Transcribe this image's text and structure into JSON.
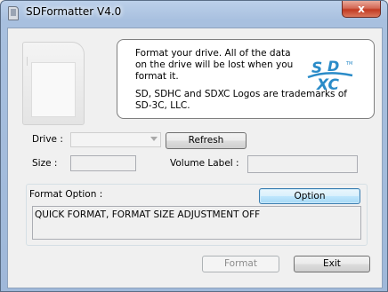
{
  "window": {
    "title": "SDFormatter V4.0",
    "close_label": "x"
  },
  "info": {
    "lines": [
      "Format your drive. All of the data",
      "on the drive will be lost when you",
      "format it."
    ],
    "trademark_lines": [
      "SD, SDHC and SDXC Logos are trademarks of",
      "SD-3C, LLC."
    ],
    "logo_text": "SDXC"
  },
  "drive": {
    "label": "Drive :",
    "selected_value": "",
    "refresh_label": "Refresh"
  },
  "size": {
    "label": "Size  :",
    "value": ""
  },
  "volume_label": {
    "label": "Volume Label :",
    "value": ""
  },
  "format_option": {
    "label": "Format Option :",
    "option_button_label": "Option",
    "status_text": "QUICK FORMAT, FORMAT SIZE ADJUSTMENT OFF"
  },
  "actions": {
    "format_label": "Format",
    "exit_label": "Exit"
  },
  "colors": {
    "title_bar": "#a8c0df",
    "close_button": "#c23a22",
    "default_button_border": "#3c7fb1",
    "logo_blue": "#2a8bc8"
  }
}
